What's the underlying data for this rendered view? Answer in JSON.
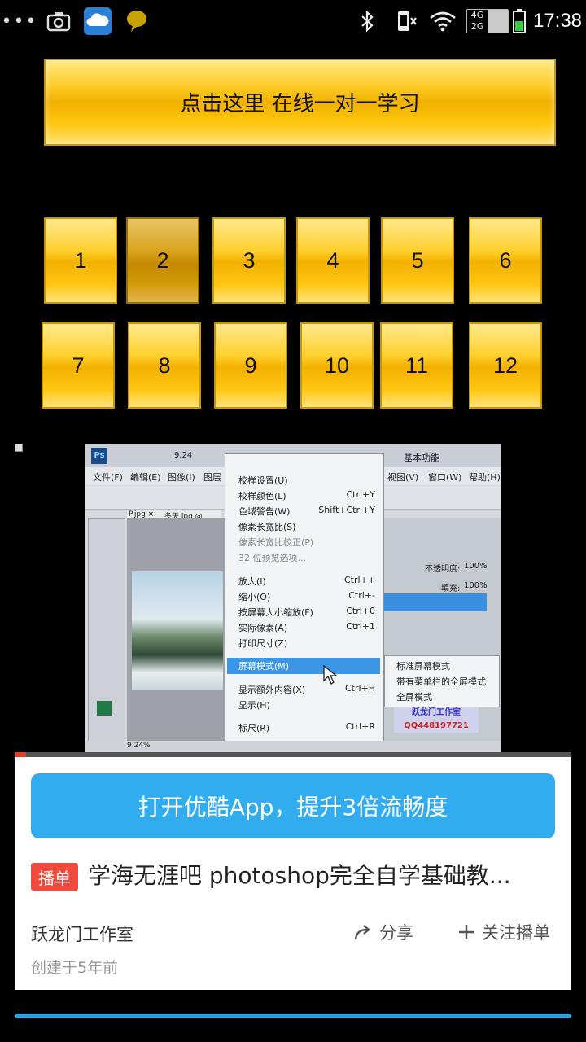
{
  "status_bar": {
    "time": "17:38",
    "network_top": "4G",
    "network_bottom": "2G",
    "icons": [
      "more-dots-icon",
      "camera-icon",
      "cloud-app-icon",
      "chat-bubble-icon",
      "bluetooth-icon",
      "silent-phone-icon",
      "wifi-icon",
      "network-type-icon",
      "battery-icon"
    ]
  },
  "banner": {
    "label": "点击这里  在线一对一学习"
  },
  "lessons": {
    "items": [
      "1",
      "2",
      "3",
      "4",
      "5",
      "6",
      "7",
      "8",
      "9",
      "10",
      "11",
      "12"
    ],
    "active": "2"
  },
  "video": {
    "screenshot": {
      "ps_menu": [
        "文件(F)",
        "编辑(E)",
        "图像(I)",
        "图层",
        "视图(V)",
        "窗口(W)",
        "帮助(H)"
      ],
      "zoom": "9.24",
      "workspace": "基本功能",
      "tabs": [
        "P.jpg ×",
        "冬天.jpg @ 9.24%"
      ],
      "opacity_label": "不透明度:",
      "opacity_value": "100%",
      "fill_label": "填充:",
      "fill_value": "100%",
      "dropdown_items": [
        {
          "label": "校样设置(U)",
          "shortcut": ""
        },
        {
          "label": "校样颜色(L)",
          "shortcut": "Ctrl+Y"
        },
        {
          "label": "色域警告(W)",
          "shortcut": "Shift+Ctrl+Y"
        },
        {
          "label": "像素长宽比(S)",
          "shortcut": ""
        },
        {
          "label": "像素长宽比校正(P)",
          "shortcut": ""
        },
        {
          "label": "32 位预览选项...",
          "shortcut": ""
        },
        {
          "label": "放大(I)",
          "shortcut": "Ctrl++"
        },
        {
          "label": "缩小(O)",
          "shortcut": "Ctrl+-"
        },
        {
          "label": "按屏幕大小缩放(F)",
          "shortcut": "Ctrl+0"
        },
        {
          "label": "实际像素(A)",
          "shortcut": "Ctrl+1"
        },
        {
          "label": "打印尺寸(Z)",
          "shortcut": ""
        },
        {
          "label": "屏幕模式(M)",
          "shortcut": ""
        },
        {
          "label": "显示额外内容(X)",
          "shortcut": "Ctrl+H"
        },
        {
          "label": "显示(H)",
          "shortcut": ""
        },
        {
          "label": "标尺(R)",
          "shortcut": "Ctrl+R"
        }
      ],
      "submenu_items": [
        "标准屏幕模式",
        "带有菜单栏的全屏模式",
        "全屏模式"
      ],
      "watermark_line1": "跃龙门工作室",
      "watermark_line2": "QQ448197721",
      "status_zoom": "9.24%"
    },
    "progress": 0.02
  },
  "card": {
    "open_app_label": "打开优酷App，提升3倍流畅度",
    "badge": "播单",
    "title": "学海无涯吧 photoshop完全自学基础教...",
    "author": "跃龙门工作室",
    "share_label": "分享",
    "follow_label": "关注播单",
    "created": "创建于5年前"
  }
}
